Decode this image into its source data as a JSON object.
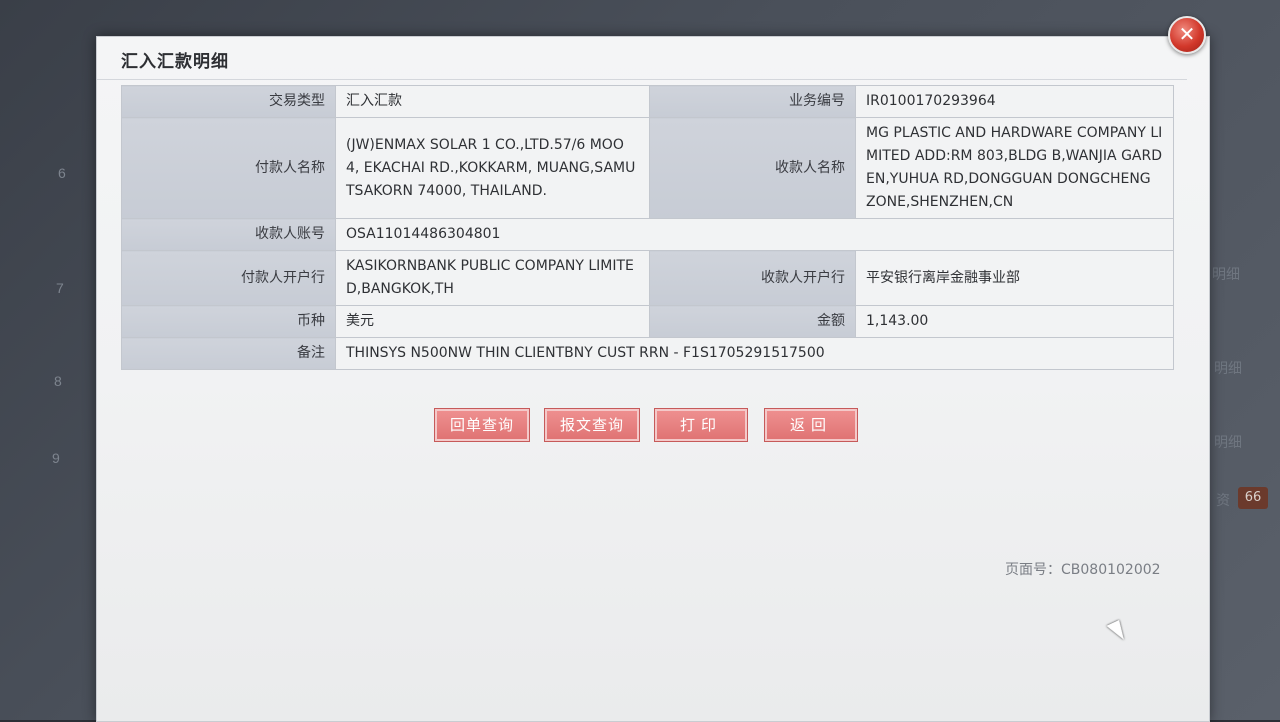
{
  "background": {
    "side_numbers": [
      "6",
      "7",
      "8",
      "9"
    ],
    "side_texts": [
      "明细",
      "明细",
      "明细",
      "资"
    ],
    "badge": "66"
  },
  "dialog": {
    "title": "汇入汇款明细",
    "close_icon": "close-icon"
  },
  "details": {
    "trade_type": {
      "label": "交易类型",
      "value": "汇入汇款"
    },
    "business_no": {
      "label": "业务编号",
      "value": "IR0100170293964"
    },
    "payer_name": {
      "label": "付款人名称",
      "value": "(JW)ENMAX SOLAR 1 CO.,LTD.57/6 MOO 4, EKACHAI RD.,KOKKARM, MUANG,SAMUTSAKORN 74000, THAILAND."
    },
    "payee_name": {
      "label": "收款人名称",
      "value": "MG PLASTIC AND HARDWARE COMPANY LIMITED ADD:RM 803,BLDG B,WANJIA GARDEN,YUHUA RD,DONGGUAN DONGCHENG ZONE,SHENZHEN,CN"
    },
    "payee_account": {
      "label": "收款人账号",
      "value": "OSA11014486304801"
    },
    "payer_bank": {
      "label": "付款人开户行",
      "value": "KASIKORNBANK PUBLIC COMPANY LIMITED,BANGKOK,TH"
    },
    "payee_bank": {
      "label": "收款人开户行",
      "value": "平安银行离岸金融事业部"
    },
    "currency": {
      "label": "币种",
      "value": "美元"
    },
    "amount": {
      "label": "金额",
      "value": "1,143.00"
    },
    "remark": {
      "label": "备注",
      "value": "THINSYS N500NW THIN CLIENTBNY CUST RRN - F1S1705291517500"
    }
  },
  "buttons": {
    "receipt_query": "回单查询",
    "message_query": "报文查询",
    "print": "打印",
    "back": "返回"
  },
  "footer": {
    "page_no": "页面号：CB080102002"
  },
  "colors": {
    "button_bg": "#e07474",
    "label_bg": "#cfd3db",
    "close_bg": "#d2382b"
  }
}
